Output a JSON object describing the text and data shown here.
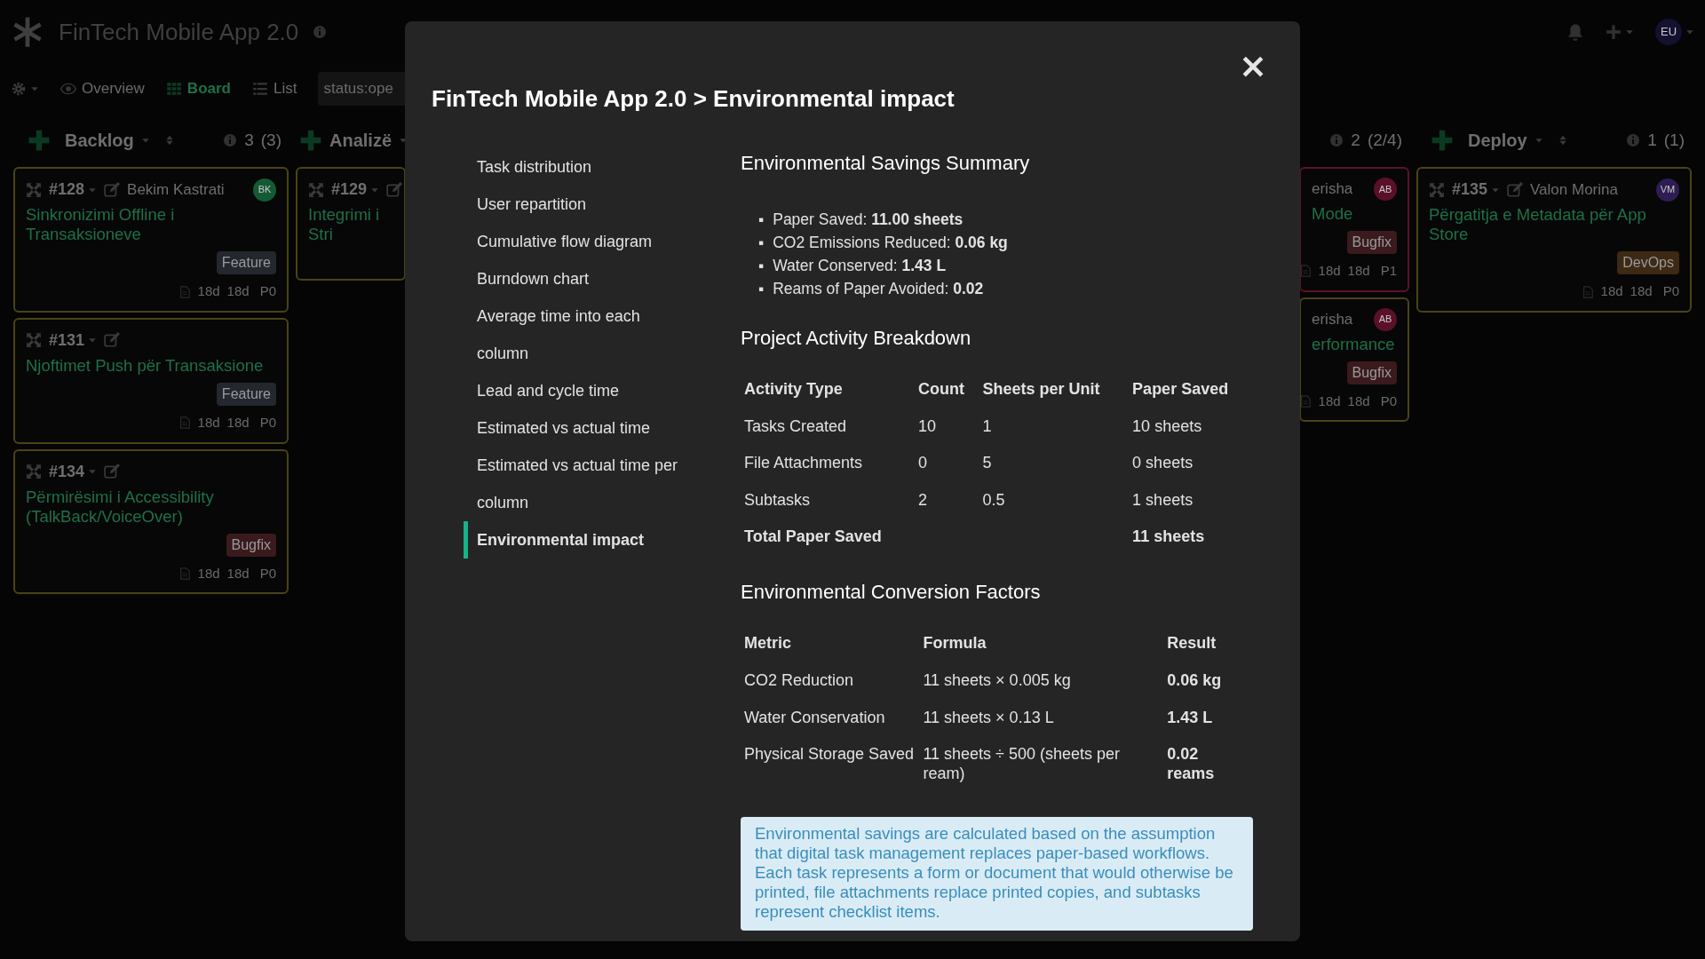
{
  "app": {
    "title": "FinTech Mobile App 2.0",
    "user_initials": "EU"
  },
  "toolbar": {
    "views": [
      {
        "label": "Overview",
        "selected": false,
        "kind": "eye"
      },
      {
        "label": "Board",
        "selected": true,
        "kind": "grid"
      },
      {
        "label": "List",
        "selected": false,
        "kind": "list"
      }
    ],
    "search": {
      "value": "status:ope"
    }
  },
  "columns": [
    {
      "name": "Backlog",
      "count": "3",
      "limit": "(3)",
      "cards": [
        {
          "id": "#128",
          "assignee": "Bekim Kastrati",
          "avatar": {
            "initials": "BK",
            "color": "#145a34"
          },
          "color": "#4a4416",
          "title": "Sinkronizimi Offline i Transaksioneve",
          "tag": {
            "label": "Feature",
            "kind": "feature"
          },
          "times": [
            "18d",
            "18d"
          ],
          "priority": "P0"
        },
        {
          "id": "#131",
          "color": "#4a4416",
          "title": "Njoftimet Push për Transaksione",
          "tag": {
            "label": "Feature",
            "kind": "feature"
          },
          "times": [
            "18d",
            "18d"
          ],
          "priority": "P0"
        },
        {
          "id": "#134",
          "color": "#4a4416",
          "title": "Përmirësimi i Accessibility (TalkBack/VoiceOver)",
          "tag": {
            "label": "Bugfix",
            "kind": "bugfix"
          },
          "times": [
            "18d",
            "18d"
          ],
          "priority": "P0"
        }
      ]
    },
    {
      "name": "Analizë",
      "cards": [
        {
          "id": "#129",
          "color": "#4a4416",
          "title": "Integrimi i Stri"
        }
      ]
    },
    {
      "count": "2",
      "limit": "(2/4)",
      "cards": [
        {
          "assignee": "erisha",
          "avatar": {
            "initials": "AB",
            "color": "#5a1029"
          },
          "color": "#5a1424",
          "title": "Mode",
          "tag": {
            "label": "Bugfix",
            "kind": "bugfix"
          },
          "times": [
            "18d",
            "18d"
          ],
          "priority": "P1"
        },
        {
          "assignee": "erisha",
          "avatar": {
            "initials": "AB",
            "color": "#5a1029"
          },
          "color": "#4a4416",
          "title": "erformance",
          "tag": {
            "label": "Bugfix",
            "kind": "bugfix"
          },
          "times": [
            "18d",
            "18d"
          ],
          "priority": "P0"
        }
      ]
    },
    {
      "name": "Deploy",
      "count": "1",
      "limit": "(1)",
      "cards": [
        {
          "id": "#135",
          "assignee": "Valon Morina",
          "avatar": {
            "initials": "VM",
            "color": "#2e1d52"
          },
          "color": "#4a4416",
          "title": "Përgatitja e Metadata për App Store",
          "tag": {
            "label": "DevOps",
            "kind": "devops"
          },
          "times": [
            "18d",
            "18d"
          ],
          "priority": "P0"
        }
      ]
    }
  ],
  "modal": {
    "title": "FinTech Mobile App 2.0 > Environmental impact",
    "nav": [
      {
        "label": "Task distribution",
        "selected": false
      },
      {
        "label": "User repartition",
        "selected": false
      },
      {
        "label": "Cumulative flow diagram",
        "selected": false
      },
      {
        "label": "Burndown chart",
        "selected": false
      },
      {
        "label": "Average time into each column",
        "selected": false
      },
      {
        "label": "Lead and cycle time",
        "selected": false
      },
      {
        "label": "Estimated vs actual time",
        "selected": false
      },
      {
        "label": "Estimated vs actual time per column",
        "selected": false
      },
      {
        "label": "Environmental impact",
        "selected": true
      }
    ],
    "summary": {
      "heading": "Environmental Savings Summary",
      "marker": "▪",
      "items": [
        "Paper Saved: **11.00 sheets**",
        "CO2 Emissions Reduced: **0.06 kg**",
        "Water Conserved: **1.43 L**",
        "Reams of Paper Avoided: **0.02**"
      ]
    },
    "activity": {
      "heading": "Project Activity Breakdown",
      "columns": [
        "Activity Type",
        "Count",
        "Sheets per Unit",
        "Paper Saved"
      ],
      "rows": [
        {
          "kind": "item",
          "cells": [
            "Tasks Created",
            "10",
            "1",
            "10 sheets"
          ]
        },
        {
          "kind": "item",
          "cells": [
            "File Attachments",
            "0",
            "5",
            "0 sheets"
          ]
        },
        {
          "kind": "item",
          "cells": [
            "Subtasks",
            "2",
            "0.5",
            "1 sheets"
          ]
        },
        {
          "kind": "total",
          "cells": [
            "Total Paper Saved",
            "",
            "",
            "11 sheets"
          ]
        }
      ]
    },
    "factors": {
      "heading": "Environmental Conversion Factors",
      "columns": [
        "Metric",
        "Formula",
        "Result"
      ],
      "rows": [
        [
          "CO2 Reduction",
          "11 sheets × 0.005 kg",
          "0.06 kg"
        ],
        [
          "Water Conservation",
          "11 sheets × 0.13 L",
          "1.43 L"
        ],
        [
          "Physical Storage Saved",
          "11 sheets ÷ 500 (sheets per ream)",
          "0.02 reams"
        ]
      ]
    },
    "note": "Environmental savings are calculated based on the assumption that digital task management replaces paper-based workflows. Each task represents a form or document that would otherwise be printed, file attachments replace printed copies, and subtasks represent checklist items."
  }
}
